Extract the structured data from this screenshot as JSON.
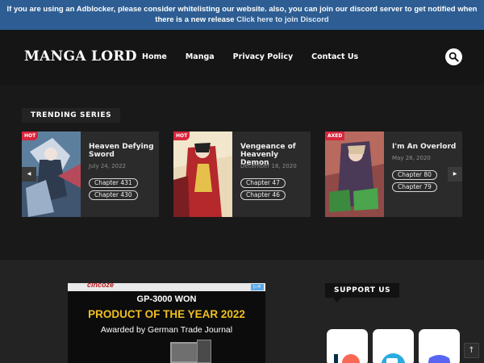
{
  "notice": {
    "text": "If you are using an Adblocker, please consider whitelisting our website. also, you can join our discord server to get notified when there is a new release",
    "link": "Click here to join Discord"
  },
  "header": {
    "logo": "MANGA LORD",
    "nav": [
      "Home",
      "Manga",
      "Privacy Policy",
      "Contact Us"
    ],
    "search_icon": "search-icon"
  },
  "trending": {
    "heading": "TRENDING SERIES",
    "cards": [
      {
        "badge": "HOT",
        "title": "Heaven Defying Sword",
        "date": "July 24, 2022",
        "chapters": [
          "Chapter 431",
          "Chapter 430"
        ]
      },
      {
        "badge": "HOT",
        "title": "Vengeance of Heavenly Demon",
        "date": "December 16, 2020",
        "chapters": [
          "Chapter 47",
          "Chapter 46"
        ]
      },
      {
        "badge": "AXED",
        "title": "I'm An Overlord",
        "date": "May 28, 2020",
        "chapters": [
          "Chapter 80",
          "Chapter 79"
        ]
      }
    ],
    "prev_icon": "chevron-left-icon",
    "next_icon": "chevron-right-icon"
  },
  "ad": {
    "brand": "cincoze",
    "line1": "GP-3000 WON",
    "line2": "PRODUCT OF THE YEAR 2022",
    "line3": "Awarded by German Trade Journal"
  },
  "support": {
    "heading": "SUPPORT US"
  },
  "colors": {
    "notice_bg": "#2d5d92",
    "hot_badge": "#d7263d",
    "ad_highlight": "#f0bf22"
  }
}
